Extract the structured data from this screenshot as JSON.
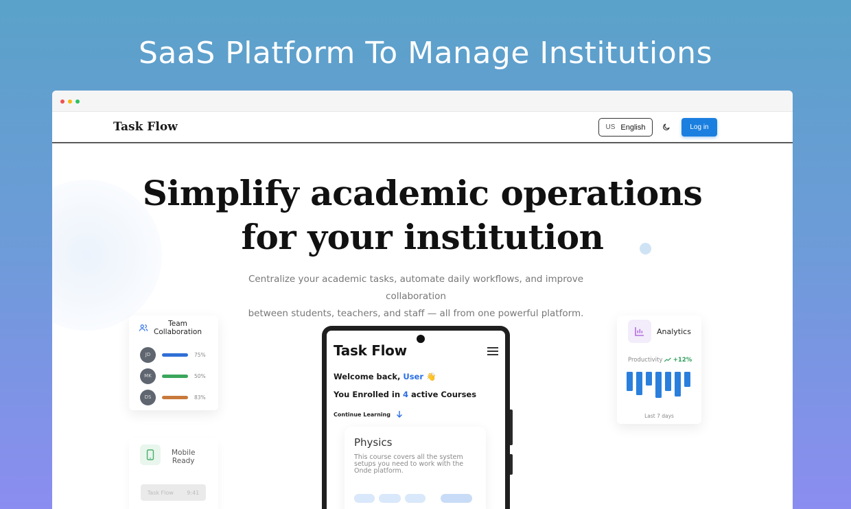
{
  "page": {
    "headline": "SaaS Platform To Manage Institutions"
  },
  "navbar": {
    "brand": "Task Flow",
    "language": {
      "flag": "US",
      "label": "English"
    },
    "theme_icon": "moon-icon",
    "login_label": "Log in"
  },
  "hero": {
    "title_line1": "Simplify academic operations",
    "title_line2": "for your institution",
    "subtitle_line1": "Centralize your academic tasks, automate daily workflows, and improve collaboration",
    "subtitle_line2": "between students, teachers, and staff — all from one powerful platform."
  },
  "team_card": {
    "title_line1": "Team",
    "title_line2": "Collaboration",
    "icon": "users-icon",
    "members": [
      {
        "initials": "JD",
        "percent": "75%",
        "color": "#2f6fd6"
      },
      {
        "initials": "MK",
        "percent": "50%",
        "color": "#3aa65c"
      },
      {
        "initials": "DS",
        "percent": "83%",
        "color": "#c87a3c"
      }
    ]
  },
  "mobile_card": {
    "title_line1": "Mobile",
    "title_line2": "Ready",
    "icon": "phone-icon",
    "pill_left": "Task Flow",
    "pill_right": "9:41"
  },
  "analytics_card": {
    "title": "Analytics",
    "icon": "bar-chart-icon",
    "productivity_label": "Productivity",
    "productivity_delta": "+12%",
    "footer": "Last 7 days",
    "bars": [
      0.7,
      0.85,
      0.5,
      0.95,
      0.7,
      0.9,
      0.55
    ],
    "bar_color": "#2b7fdc"
  },
  "phone": {
    "brand": "Task Flow",
    "welcome_prefix": "Welcome back, ",
    "welcome_user": "User",
    "welcome_emoji": "👋",
    "enrolled_prefix": "You Enrolled in ",
    "enrolled_count": "4",
    "enrolled_suffix": " active Courses",
    "continue_label": "Continue Learning",
    "course": {
      "title": "Physics",
      "description": "This course covers all the system setups you need to work with the Onde platform."
    }
  }
}
